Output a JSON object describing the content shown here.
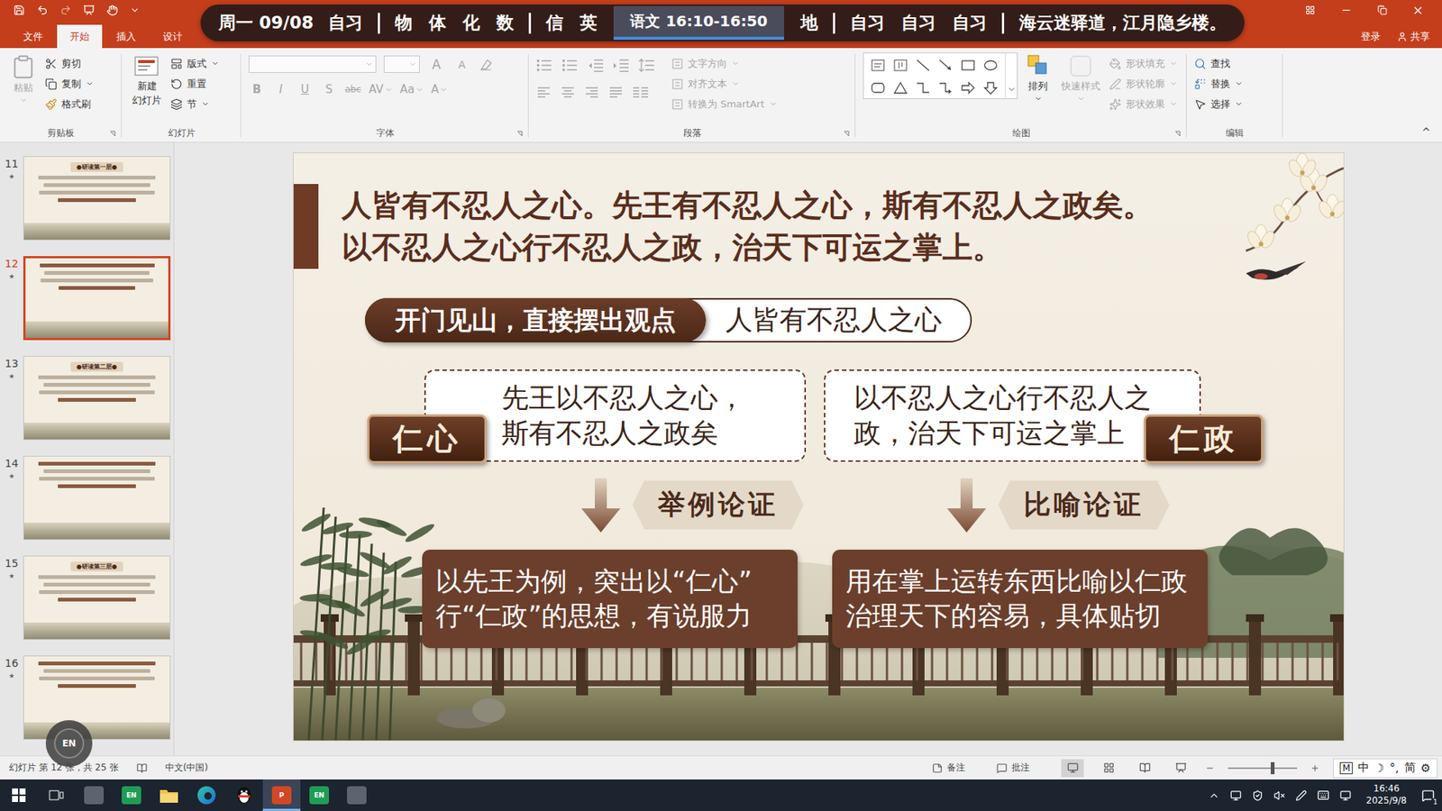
{
  "schedule": {
    "day": "周一 09/08",
    "groups": [
      [
        {
          "label": "自习",
          "selected": false
        }
      ],
      [
        {
          "label": "物",
          "selected": false
        },
        {
          "label": "体",
          "selected": false
        },
        {
          "label": "化",
          "selected": false
        },
        {
          "label": "数",
          "selected": false
        }
      ],
      [
        {
          "label": "信",
          "selected": false
        },
        {
          "label": "英",
          "selected": false
        },
        {
          "label": "语文 16:10-16:50",
          "selected": true
        },
        {
          "label": "地",
          "selected": false
        }
      ],
      [
        {
          "label": "自习",
          "selected": false
        },
        {
          "label": "自习",
          "selected": false
        },
        {
          "label": "自习",
          "selected": false
        }
      ]
    ],
    "motto": "海云迷驿道，江月隐乡楼。"
  },
  "menu": {
    "tabs": [
      {
        "label": "文件",
        "selected": false
      },
      {
        "label": "开始",
        "selected": true
      },
      {
        "label": "插入",
        "selected": false
      },
      {
        "label": "设计",
        "selected": false
      }
    ],
    "account": "登录",
    "share": "共享"
  },
  "ribbon": {
    "clipboard": {
      "label": "剪贴板",
      "paste": {
        "label": "粘贴",
        "disabled": true
      },
      "tools": [
        {
          "label": "剪切",
          "kind": "cut",
          "dropdown": false,
          "disabled": false
        },
        {
          "label": "复制",
          "kind": "copy",
          "dropdown": true,
          "disabled": false
        },
        {
          "label": "格式刷",
          "kind": "brush",
          "dropdown": false,
          "disabled": false
        }
      ]
    },
    "slides": {
      "label": "幻灯片",
      "new_slide": [
        "新建",
        "幻灯片"
      ],
      "tools": [
        {
          "label": "版式",
          "kind": "layout",
          "dropdown": true,
          "disabled": false
        },
        {
          "label": "重置",
          "kind": "reset",
          "dropdown": false,
          "disabled": false
        },
        {
          "label": "节",
          "kind": "section",
          "dropdown": true,
          "disabled": false
        }
      ]
    },
    "font": {
      "label": "字体",
      "disabled": true,
      "size_buttons": [
        "A",
        "A"
      ],
      "format_buttons": [
        {
          "label": "B",
          "kind": "bold"
        },
        {
          "label": "I",
          "kind": "italic"
        },
        {
          "label": "U",
          "kind": "underline"
        },
        {
          "label": "S",
          "kind": "shadow"
        },
        {
          "label": "abc",
          "kind": "strike"
        },
        {
          "label": "AV",
          "kind": "spacing"
        },
        {
          "label": "Aa",
          "kind": "case"
        },
        {
          "label": "A",
          "kind": "color"
        }
      ]
    },
    "paragraph": {
      "label": "段落",
      "disabled": true,
      "tools": [
        {
          "label": "文字方向"
        },
        {
          "label": "对齐文本"
        },
        {
          "label": "转换为 SmartArt"
        }
      ]
    },
    "drawing": {
      "label": "绘图",
      "arrange": {
        "label": "排列",
        "disabled": false
      },
      "quick_styles": {
        "label": "快速样式",
        "disabled": true
      },
      "tools": [
        {
          "label": "形状填充",
          "kind": "fill",
          "disabled": true
        },
        {
          "label": "形状轮廓",
          "kind": "outline",
          "disabled": true
        },
        {
          "label": "形状效果",
          "kind": "effect",
          "disabled": true
        }
      ]
    },
    "editing": {
      "label": "编辑",
      "tools": [
        {
          "label": "查找",
          "kind": "find",
          "dropdown": false,
          "disabled": false
        },
        {
          "label": "替换",
          "kind": "replace",
          "dropdown": true,
          "disabled": false
        },
        {
          "label": "选择",
          "kind": "select",
          "dropdown": true,
          "disabled": false
        }
      ]
    }
  },
  "thumbnails": [
    {
      "number": "11",
      "marker": "★",
      "title": "●研读第一层●",
      "selected": false
    },
    {
      "number": "12",
      "marker": "★",
      "selected": true
    },
    {
      "number": "13",
      "marker": "★",
      "title": "●研读第二层●",
      "selected": false
    },
    {
      "number": "14",
      "marker": "★",
      "selected": false
    },
    {
      "number": "15",
      "marker": "★",
      "title": "●研读第三层●",
      "selected": false
    },
    {
      "number": "16",
      "marker": "★",
      "selected": false
    }
  ],
  "slide": {
    "heading": [
      "人皆有不忍人之心。先王有不忍人之心，斯有不忍人之政矣。",
      "以不忍人之心行不忍人之政，治天下可运之掌上。"
    ],
    "thesis": {
      "label": "开门见山，直接摆出观点",
      "value": "人皆有不忍人之心"
    },
    "columns": [
      {
        "badge": "仁心",
        "text": [
          "先王以不忍人之心，",
          "斯有不忍人之政矣"
        ],
        "method": "举例论证",
        "comment": [
          "以先王为例，突出以“仁心”",
          "行“仁政”的思想，有说服力"
        ]
      },
      {
        "badge": "仁政",
        "text": [
          "以不忍人之心行不忍人之",
          "政，治天下可运之掌上"
        ],
        "method": "比喻论证",
        "comment": [
          "用在掌上运转东西比喻以仁政",
          "治理天下的容易，具体贴切"
        ]
      }
    ]
  },
  "floating_badge": "EN",
  "status_bar": {
    "slide_info": "幻灯片 第 12 张，共 25 张",
    "language": "中文(中国)",
    "notes": "备注",
    "comments": "批注",
    "zoom_level": 0.64
  },
  "ime": [
    "M",
    "中",
    "☽",
    "°,",
    "简",
    "⚙"
  ],
  "taskbar": {
    "apps": [
      {
        "kind": "camera",
        "selected": false
      },
      {
        "kind": "en",
        "label": "EN",
        "selected": false
      },
      {
        "kind": "explorer",
        "selected": false
      },
      {
        "kind": "edge",
        "selected": false
      },
      {
        "kind": "qq",
        "selected": false
      },
      {
        "kind": "powerpoint",
        "label": "P",
        "selected": true
      },
      {
        "kind": "en",
        "label": "EN",
        "selected": false
      },
      {
        "kind": "camera",
        "selected": false
      }
    ],
    "time": "16:46",
    "date": "2025/9/8",
    "notifications": "1"
  }
}
